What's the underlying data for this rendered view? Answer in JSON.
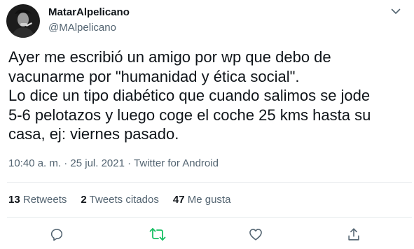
{
  "author": {
    "display_name": "MatarAlpelicano",
    "handle": "@MAlpelicano"
  },
  "tweet": {
    "text": "Ayer me escribió un amigo por wp que debo de\nvacunarme por \"humanidad y ética social\".\nLo dice un tipo diabético que cuando salimos se jode\n5-6 pelotazos y luego coge el coche 25 kms hasta su\ncasa, ej: viernes pasado.",
    "time": "10:40 a. m.",
    "separator": " · ",
    "date": "25 jul. 2021",
    "source": "Twitter for Android"
  },
  "stats": {
    "retweets_count": "13",
    "retweets_label": "Retweets",
    "quotes_count": "2",
    "quotes_label": "Tweets citados",
    "likes_count": "47",
    "likes_label": "Me gusta"
  },
  "icons": {
    "more": "chevron-down-icon",
    "reply": "reply-icon",
    "retweet": "retweet-icon",
    "like": "heart-icon",
    "share": "share-icon"
  },
  "colors": {
    "text": "#0f1419",
    "secondary": "#536471",
    "retweet_green": "#17bf63",
    "divider": "#e5e9ec"
  }
}
